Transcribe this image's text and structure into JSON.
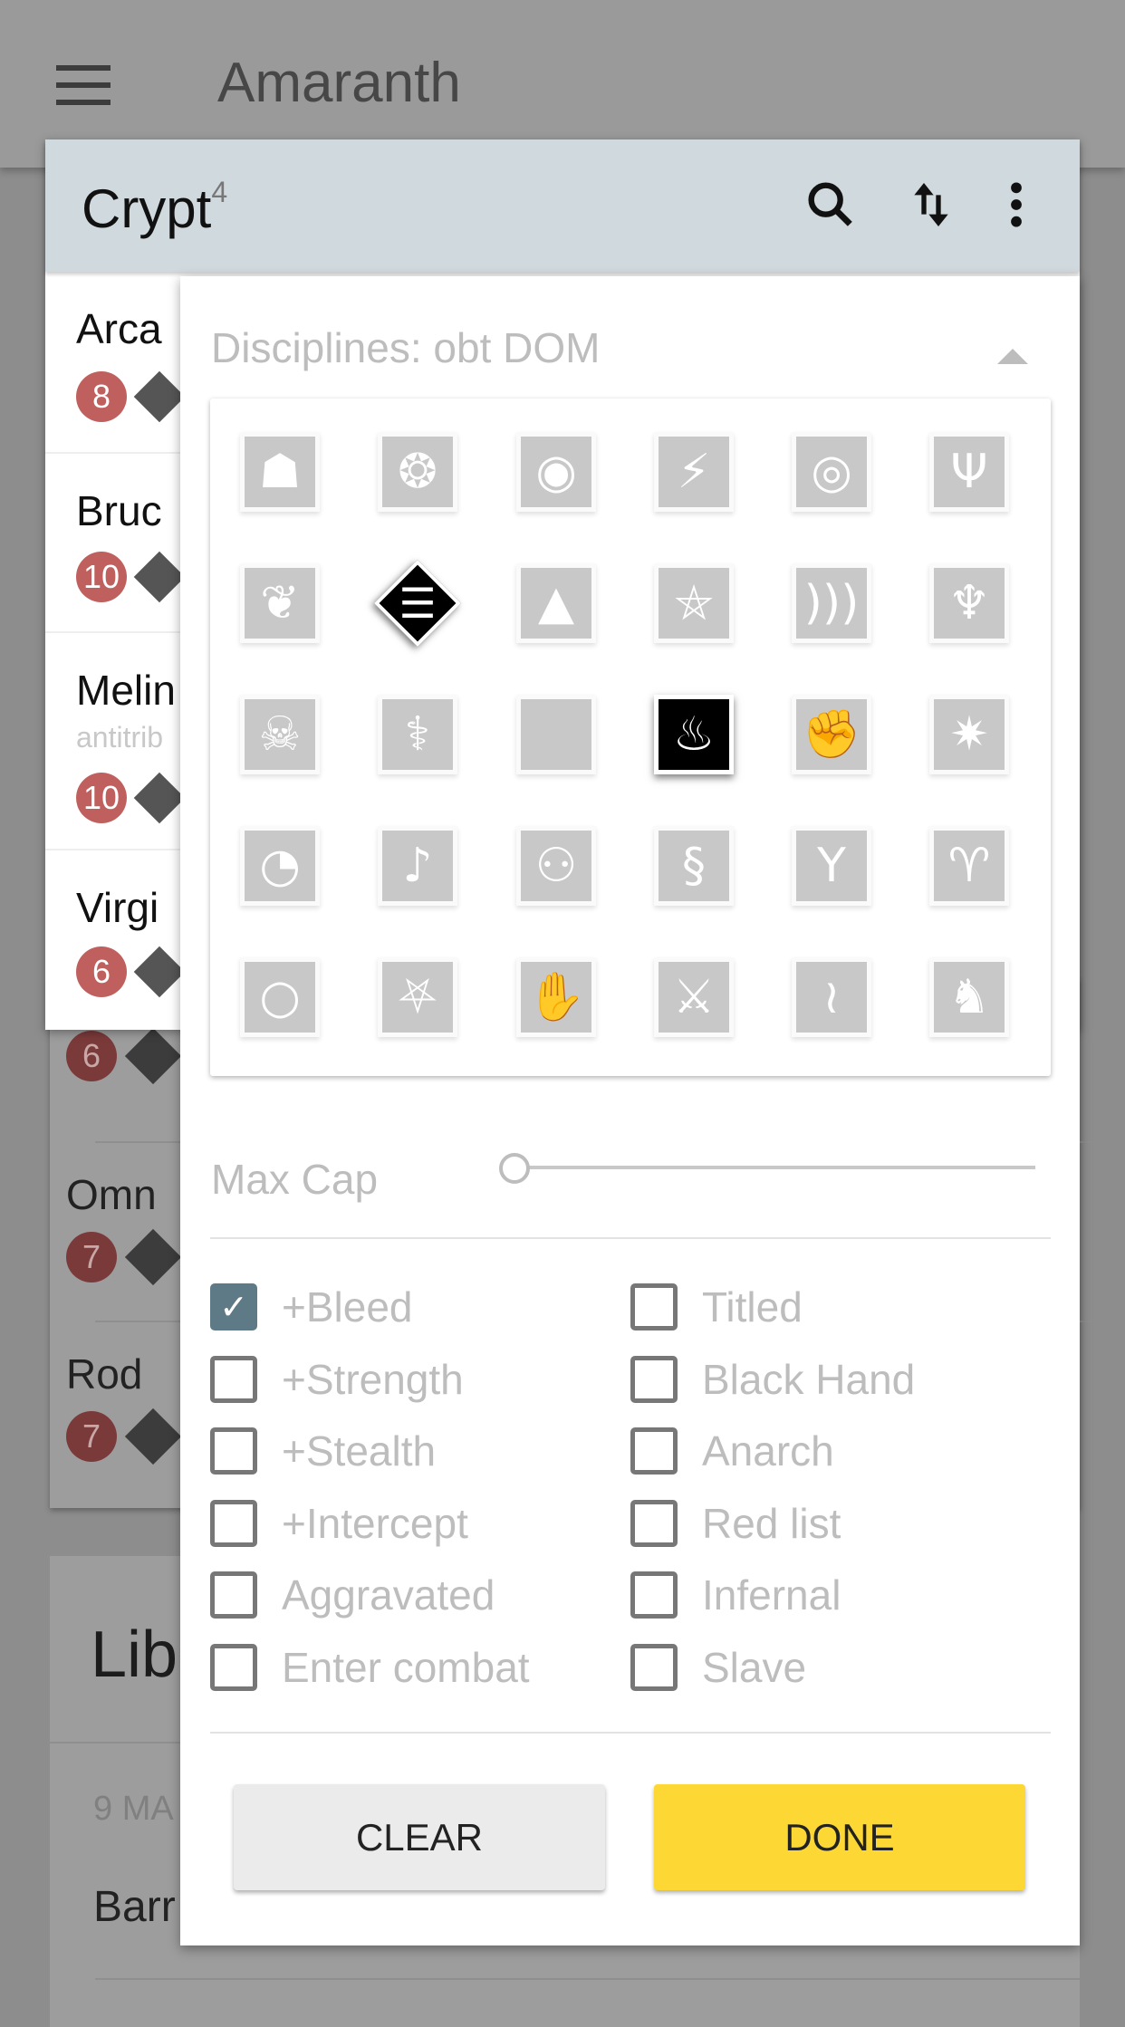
{
  "app": {
    "title": "Amaranth",
    "menu_icon": "hamburger-icon"
  },
  "crypt": {
    "title": "Crypt",
    "count": "4",
    "rows": [
      {
        "name": "Arca",
        "capacity": "8"
      },
      {
        "name": "Bruc",
        "capacity": "10"
      },
      {
        "name": "Melin",
        "subtitle": "antitrib",
        "capacity": "10"
      },
      {
        "name": "Virgi",
        "capacity": "6"
      }
    ],
    "icons": {
      "search": "search-icon",
      "sort": "sort-icon",
      "more": "more-vert-icon"
    }
  },
  "background": {
    "crypt_rows": [
      {
        "capacity": "6"
      },
      {
        "name": "Omn",
        "capacity": "7"
      },
      {
        "name": "Rod",
        "capacity": "7"
      }
    ],
    "library": {
      "title": "Lib",
      "date": "9 MA",
      "item": "Barr"
    }
  },
  "filter": {
    "disciplines_label": "Disciplines: obt DOM",
    "disciplines": [
      {
        "icon": "lion-icon",
        "glyph": "☗",
        "state": "off"
      },
      {
        "icon": "paw-icon",
        "glyph": "❂",
        "state": "off"
      },
      {
        "icon": "eye-icon",
        "glyph": "◉",
        "state": "off"
      },
      {
        "icon": "lightning-icon",
        "glyph": "⚡",
        "state": "off"
      },
      {
        "icon": "spiral-icon",
        "glyph": "◎",
        "state": "off"
      },
      {
        "icon": "trident-icon",
        "glyph": "Ψ",
        "state": "off"
      },
      {
        "icon": "brain-icon",
        "glyph": "❦",
        "state": "off"
      },
      {
        "icon": "dominate-icon",
        "glyph": "☰",
        "state": "superior"
      },
      {
        "icon": "mountain-icon",
        "glyph": "▲",
        "state": "off"
      },
      {
        "icon": "pentagram-icon",
        "glyph": "⛤",
        "state": "off"
      },
      {
        "icon": "sound-waves-icon",
        "glyph": ")))",
        "state": "off"
      },
      {
        "icon": "chalice-icon",
        "glyph": "♆",
        "state": "off"
      },
      {
        "icon": "skull-icon",
        "glyph": "☠",
        "state": "off"
      },
      {
        "icon": "caduceus-icon",
        "glyph": "⚕",
        "state": "off"
      },
      {
        "icon": "blank-icon",
        "glyph": "",
        "state": "off"
      },
      {
        "icon": "flames-icon",
        "glyph": "♨",
        "state": "inferior"
      },
      {
        "icon": "fist-icon",
        "glyph": "✊",
        "state": "off"
      },
      {
        "icon": "star-icon",
        "glyph": "✷",
        "state": "off"
      },
      {
        "icon": "claw-icon",
        "glyph": "◔",
        "state": "off"
      },
      {
        "icon": "quill-icon",
        "glyph": "♪",
        "state": "off"
      },
      {
        "icon": "twins-icon",
        "glyph": "⚇",
        "state": "off"
      },
      {
        "icon": "serpent-icon",
        "glyph": "§",
        "state": "off"
      },
      {
        "icon": "bird-icon",
        "glyph": "Y",
        "state": "off"
      },
      {
        "icon": "ram-horns-icon",
        "glyph": "♈",
        "state": "off"
      },
      {
        "icon": "ring-icon",
        "glyph": "○",
        "state": "off"
      },
      {
        "icon": "sigil-icon",
        "glyph": "⛧",
        "state": "off"
      },
      {
        "icon": "hand-icon",
        "glyph": "✋",
        "state": "off"
      },
      {
        "icon": "sword-icon",
        "glyph": "⚔",
        "state": "off"
      },
      {
        "icon": "tendrils-icon",
        "glyph": "≀",
        "state": "off"
      },
      {
        "icon": "dragon-icon",
        "glyph": "♞",
        "state": "off"
      }
    ],
    "max_cap_label": "Max Cap",
    "max_cap_value": 0,
    "checkboxes_left": [
      {
        "label": "+Bleed",
        "checked": true
      },
      {
        "label": "+Strength",
        "checked": false
      },
      {
        "label": "+Stealth",
        "checked": false
      },
      {
        "label": "+Intercept",
        "checked": false
      },
      {
        "label": "Aggravated",
        "checked": false
      },
      {
        "label": "Enter combat",
        "checked": false
      }
    ],
    "checkboxes_right": [
      {
        "label": "Titled",
        "checked": false
      },
      {
        "label": "Black Hand",
        "checked": false
      },
      {
        "label": "Anarch",
        "checked": false
      },
      {
        "label": "Red list",
        "checked": false
      },
      {
        "label": "Infernal",
        "checked": false
      },
      {
        "label": "Slave",
        "checked": false
      }
    ],
    "clear_label": "CLEAR",
    "done_label": "DONE",
    "colors": {
      "done": "#fdd835",
      "checkbox_on": "#5e7a87",
      "capacity_badge": "#c0605e",
      "header": "#d0d9dd"
    }
  }
}
